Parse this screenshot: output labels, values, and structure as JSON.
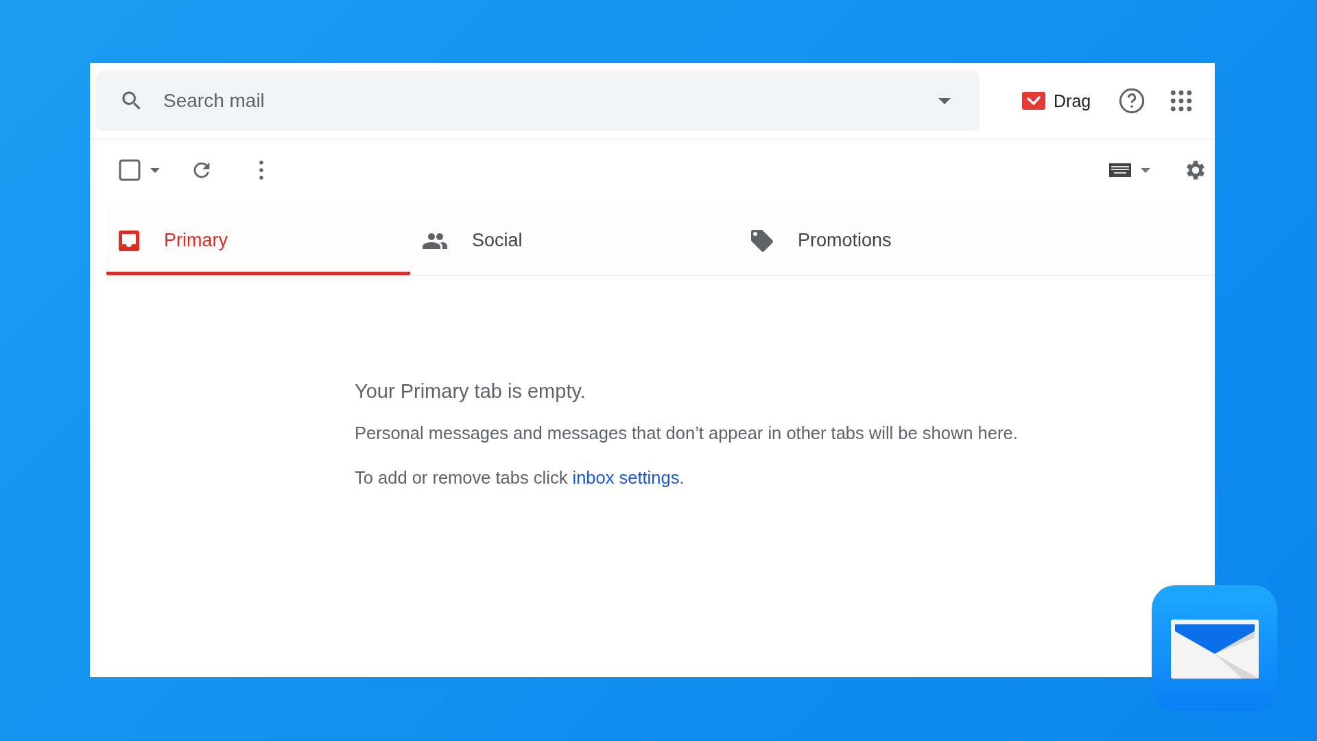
{
  "search": {
    "placeholder": "Search mail"
  },
  "account": {
    "label": "Drag"
  },
  "tabs": [
    {
      "kind": "inbox",
      "label": "Primary",
      "selected": true
    },
    {
      "kind": "people",
      "label": "Social",
      "selected": false
    },
    {
      "kind": "tag",
      "label": "Promotions",
      "selected": false
    }
  ],
  "select_all": {
    "checked": false
  },
  "empty_state": {
    "heading": "Your Primary tab is empty.",
    "message": "Personal messages and messages that don’t appear in other tabs will be shown here.",
    "hint_prefix": "To add or remove tabs click ",
    "hint_link": "inbox settings",
    "hint_suffix": "."
  }
}
